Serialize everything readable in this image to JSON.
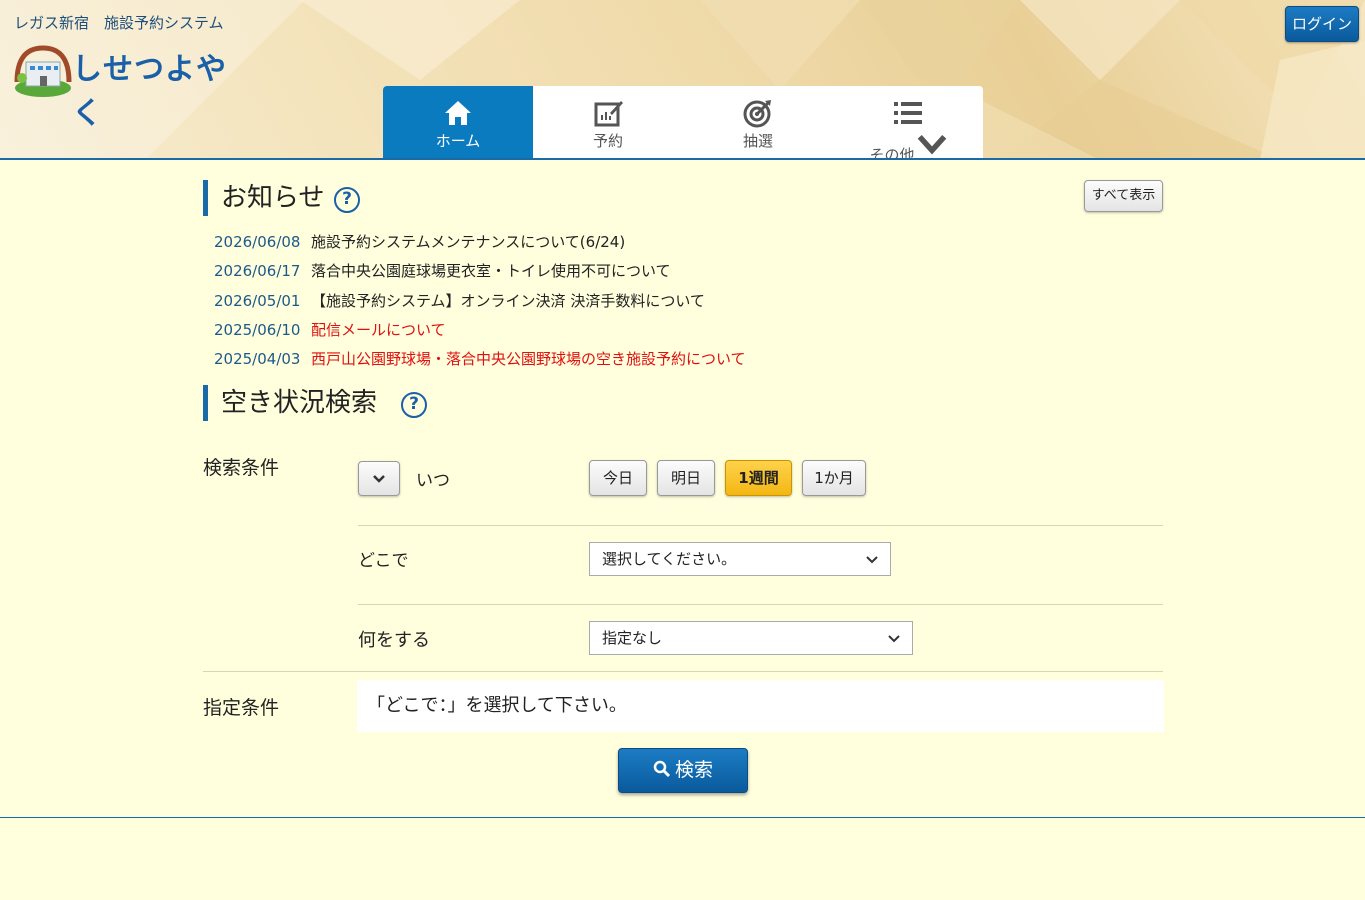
{
  "header": {
    "site_subtitle": "レガス新宿　施設予約システム",
    "logo_text": "しせつよやく",
    "login_label": "ログイン"
  },
  "nav": {
    "items": [
      {
        "label": "ホーム",
        "icon": "home-icon"
      },
      {
        "label": "予約",
        "icon": "edit-icon"
      },
      {
        "label": "抽選",
        "icon": "target-icon"
      },
      {
        "label": "その他",
        "icon": "list-icon"
      }
    ],
    "active": "ホーム"
  },
  "news": {
    "title": "お知らせ",
    "show_all_label": "すべて表示",
    "items": [
      {
        "date": "2026/06/08",
        "text": "施設予約システムメンテナンスについて(6/24)",
        "color": "#222222"
      },
      {
        "date": "2026/06/17",
        "text": "落合中央公園庭球場更衣室・トイレ使用不可について",
        "color": "#222222"
      },
      {
        "date": "2026/05/01",
        "text": "【施設予約システム】オンライン決済 決済手数料について",
        "color": "#222222"
      },
      {
        "date": "2025/06/10",
        "text": "配信メールについて",
        "color": "#e01010"
      },
      {
        "date": "2025/04/03",
        "text": "西戸山公園野球場・落合中央公園野球場の空き施設予約について",
        "color": "#e01010"
      }
    ]
  },
  "search": {
    "title": "空き状況検索",
    "criteria_label": "検索条件",
    "when_label": "いつ",
    "date_buttons": [
      "今日",
      "明日",
      "1週間",
      "1か月"
    ],
    "selected_date_button": "1週間",
    "where_label": "どこで",
    "where_value": "選択してください。",
    "what_label": "何をする",
    "what_value": "指定なし",
    "conditions_label": "指定条件",
    "conditions_text": "「どこで：」を選択して下さい。",
    "search_label": "検索"
  },
  "colors": {
    "accent": "#0a7bbf",
    "background": "#fffedd",
    "selected_button": "#f3b714",
    "alert_text": "#e01010"
  }
}
